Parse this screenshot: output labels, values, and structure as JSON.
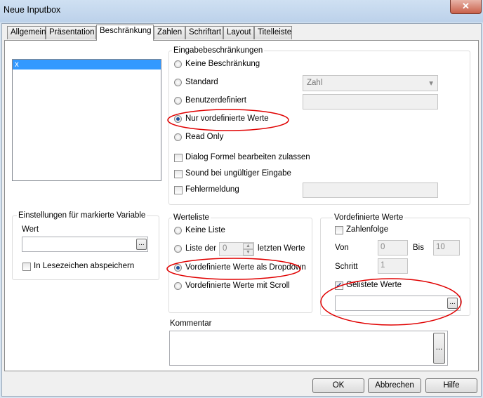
{
  "window": {
    "title": "Neue Inputbox",
    "close_glyph": "✕"
  },
  "tabs": [
    "Allgemein",
    "Präsentation",
    "Beschränkung",
    "Zahlen",
    "Schriftart",
    "Layout",
    "Titelleiste"
  ],
  "active_tab": "Beschränkung",
  "variable_list": {
    "items": [
      "x"
    ],
    "selected": "x"
  },
  "eingabe": {
    "title": "Eingabebeschränkungen",
    "radios": [
      "Keine Beschränkung",
      "Standard",
      "Benutzerdefiniert",
      "Nur vordefinierte Werte",
      "Read Only"
    ],
    "selected": "Nur vordefinierte Werte",
    "standard_dropdown_value": "Zahl",
    "checkboxes": [
      {
        "label": "Dialog Formel bearbeiten zulassen",
        "checked": false
      },
      {
        "label": "Sound bei ungültiger Eingabe",
        "checked": false
      },
      {
        "label": "Fehlermeldung",
        "checked": false
      }
    ]
  },
  "einstellungen": {
    "title": "Einstellungen für markierte Variable",
    "wert_label": "Wert",
    "wert_value": "",
    "bookmark_label": "In Lesezeichen abspeichern",
    "bookmark_checked": false
  },
  "werteliste": {
    "title": "Werteliste",
    "radios": [
      "Keine Liste",
      "Liste der",
      "Vordefinierte Werte als Dropdown",
      "Vordefinierte Werte mit Scroll"
    ],
    "liste_der_value": "0",
    "liste_der_suffix": "letzten Werte",
    "selected": "Vordefinierte Werte als Dropdown"
  },
  "vordefiniert": {
    "title": "Vordefinierte Werte",
    "zahlenfolge_label": "Zahlenfolge",
    "zahlenfolge_checked": false,
    "von_label": "Von",
    "von_value": "0",
    "bis_label": "Bis",
    "bis_value": "10",
    "schritt_label": "Schritt",
    "schritt_value": "1",
    "gelistete_label": "Gelistete Werte",
    "gelistete_checked": true,
    "gelistete_value": ""
  },
  "kommentar": {
    "label": "Kommentar",
    "value": ""
  },
  "buttons": {
    "ok": "OK",
    "cancel": "Abbrechen",
    "help": "Hilfe",
    "ellipsis": "...",
    "check_glyph": "✓",
    "dropdown_glyph": "▾"
  },
  "annotation_color": "#e00000"
}
